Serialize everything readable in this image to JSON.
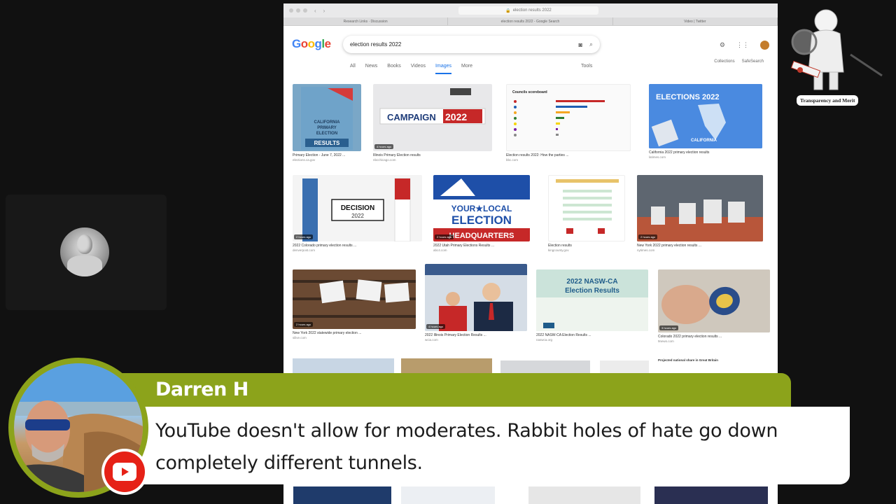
{
  "browser": {
    "url": "election results 2022",
    "tabs": [
      "Research Links · Discussion",
      "election results 2022 - Google Search",
      "Video | Twitter"
    ],
    "search_query": "election results 2022",
    "google_logo": "Google",
    "search_tabs": [
      "All",
      "News",
      "Books",
      "Videos",
      "Images",
      "More"
    ],
    "active_tab": "Images",
    "tools_label": "Tools",
    "collections_label": "Collections",
    "safesearch_label": "SafeSearch",
    "images": [
      {
        "caption": "Primary Election - June 7, 2022 ...",
        "source": "elections.ca.gov",
        "thumb_text": "CALIFORNIA PRIMARY ELECTION RESULTS",
        "badge": ""
      },
      {
        "caption": "Illinois Primary Election results",
        "source": "nbcchicago.com",
        "thumb_text": "CAMPAIGN 2022",
        "badge": "4 hours ago"
      },
      {
        "caption": "Election results 2022: How the parties ...",
        "source": "bbc.com",
        "thumb_text": "Councils scoreboard",
        "badge": ""
      },
      {
        "caption": "California 2022 primary election results",
        "source": "latimes.com",
        "thumb_text": "ELECTIONS 2022",
        "badge": ""
      },
      {
        "caption": "2022 Colorado primary election results ...",
        "source": "denverpost.com",
        "thumb_text": "DECISION 2022",
        "badge": "2 hours ago"
      },
      {
        "caption": "2022 Utah Primary Elections Results ...",
        "source": "abc4.com",
        "thumb_text": "YOUR LOCAL ELECTION HEADQUARTERS",
        "badge": "2 hours ago"
      },
      {
        "caption": "Election results",
        "source": "kingcounty.gov",
        "thumb_text": "",
        "badge": ""
      },
      {
        "caption": "New York 2022 primary election results ...",
        "source": "nytimes.com",
        "thumb_text": "",
        "badge": "2 hours ago"
      },
      {
        "caption": "New York 2022 statewide primary election ...",
        "source": "silive.com",
        "thumb_text": "",
        "badge": "2 hours ago"
      },
      {
        "caption": "2022 Illinois Primary Election Results ...",
        "source": "wcia.com",
        "thumb_text": "",
        "badge": "4 hours ago"
      },
      {
        "caption": "2022 NASW-CA Election Results ...",
        "source": "naswca.org",
        "thumb_text": "2022 NASW-CA Election Results",
        "badge": ""
      },
      {
        "caption": "Colorado 2022 primary election results ...",
        "source": "9news.com",
        "thumb_text": "",
        "badge": "3 hours ago"
      }
    ],
    "projected_text": "Projected national share in Great Britain"
  },
  "brand": {
    "caption": "Transparency and Merit"
  },
  "chat": {
    "author": "Darren H",
    "message": "YouTube doesn't allow for moderates. Rabbit holes of hate go down completely different tunnels."
  },
  "colors": {
    "chat_accent": "#8ca31b",
    "youtube_red": "#e62117"
  }
}
